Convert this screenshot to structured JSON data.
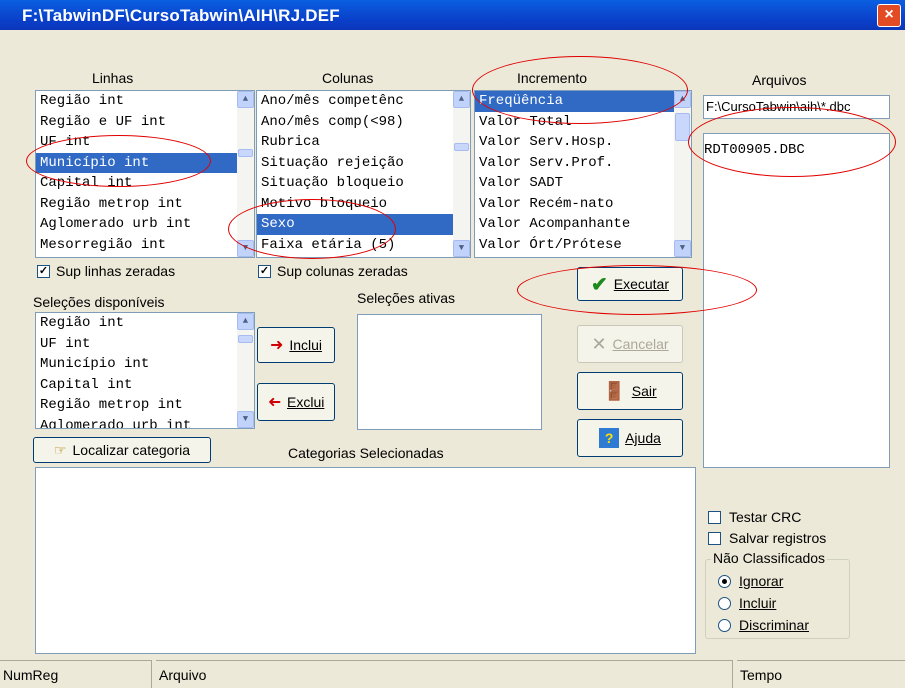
{
  "window": {
    "title": "F:\\TabwinDF\\CursoTabwin\\AIH\\RJ.DEF",
    "close_label": "×"
  },
  "headers": {
    "linhas": "Linhas",
    "colunas": "Colunas",
    "incremento": "Incremento",
    "arquivos": "Arquivos"
  },
  "linhas": {
    "items": [
      "Região int",
      "Região e UF int",
      "UF int",
      "Município int",
      "Capital int",
      "Região metrop int",
      "Aglomerado urb int",
      "Mesorregião int"
    ],
    "selected_index": 3
  },
  "colunas": {
    "items": [
      "Ano/mês competênc",
      "Ano/mês comp(<98)",
      "Rubrica",
      "Situação rejeição",
      "Situação bloqueio",
      "Motivo bloqueio",
      "Sexo",
      "Faixa etária (5)"
    ],
    "selected_index": 6
  },
  "incremento": {
    "items": [
      "Freqüência",
      "Valor Total",
      "Valor Serv.Hosp.",
      "Valor Serv.Prof.",
      "Valor SADT",
      "Valor Recém-nato",
      "Valor Acompanhante",
      "Valor Órt/Prótese"
    ],
    "selected_index": 0
  },
  "arquivos": {
    "path": "F:\\CursoTabwin\\aih\\*.dbc",
    "files": [
      "RDT00905.DBC"
    ],
    "selected_index": 0
  },
  "checks": {
    "sup_linhas": {
      "label": "Sup linhas zeradas",
      "checked": true
    },
    "sup_colunas": {
      "label": "Sup colunas zeradas",
      "checked": true
    },
    "testar_crc": {
      "label": "Testar CRC",
      "checked": false
    },
    "salvar_registros": {
      "label": "Salvar registros",
      "checked": false
    }
  },
  "selecoes": {
    "disponiveis_label": "Seleções disponíveis",
    "ativas_label": "Seleções ativas",
    "disponiveis": [
      "Região int",
      "UF int",
      "Município int",
      "Capital int",
      "Região metrop int",
      "Aglomerado urb int"
    ]
  },
  "buttons": {
    "inclui": "Inclui",
    "exclui": "Exclui",
    "executar": "Executar",
    "cancelar": "Cancelar",
    "sair": "Sair",
    "ajuda": "Ajuda",
    "localizar": "Localizar categoria"
  },
  "categorias_label": "Categorias Selecionadas",
  "nao_classificados": {
    "legend": "Não Classificados",
    "options": [
      "Ignorar",
      "Incluir",
      "Discriminar"
    ],
    "selected_index": 0
  },
  "status": {
    "numreg": "NumReg",
    "arquivo": "Arquivo",
    "tempo": "Tempo"
  },
  "colors": {
    "title_blue": "#0a3ec9",
    "selection": "#316ac5",
    "annotation": "#e00000"
  }
}
